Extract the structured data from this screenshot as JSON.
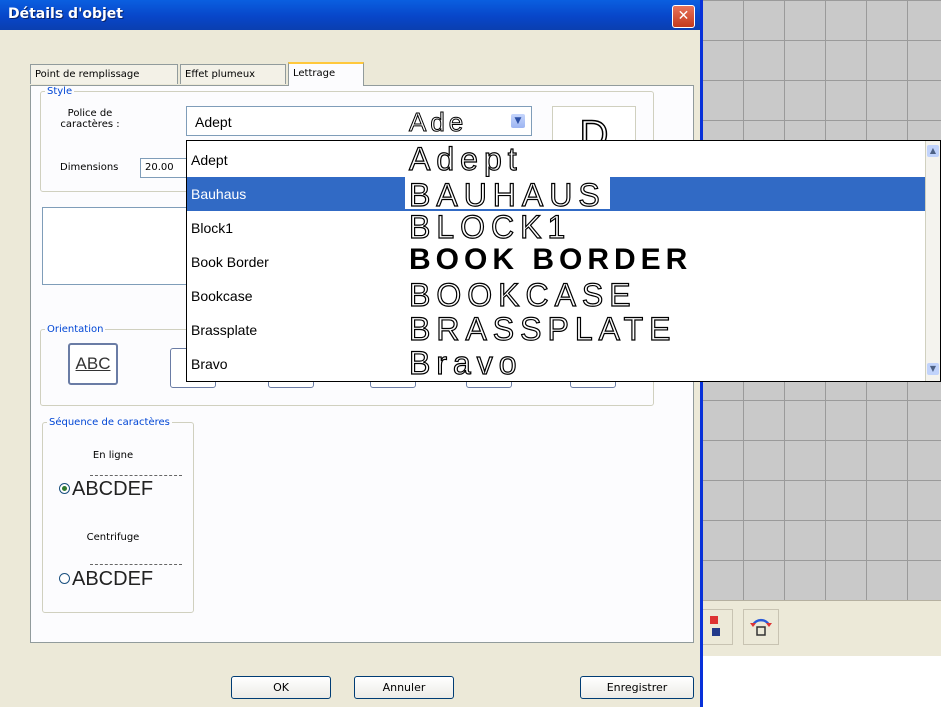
{
  "window": {
    "title": "Détails d'objet",
    "close_glyph": "✕"
  },
  "tabs": [
    {
      "label": "Point de remplissage"
    },
    {
      "label": "Effet plumeux"
    },
    {
      "label": "Lettrage"
    }
  ],
  "style_group": {
    "legend": "Style",
    "font_label_line1": "Police de",
    "font_label_line2": "caractères :",
    "font_value": "Adept",
    "font_preview": "Ade",
    "glyph_preview": "D",
    "dimensions_label": "Dimensions",
    "dimensions_value": "20.00"
  },
  "orientation_group": {
    "legend": "Orientation",
    "selected_label": "ABC"
  },
  "sequence_group": {
    "legend": "Séquence de caractères",
    "option1_label": "En ligne",
    "option1_sample": "ABCDEF",
    "option1_checked": true,
    "option2_label": "Centrifuge",
    "option2_sample": "ABCDEF",
    "option2_checked": false
  },
  "buttons": {
    "ok": "OK",
    "cancel": "Annuler",
    "save": "Enregistrer"
  },
  "font_dropdown": {
    "selected": "Bauhaus",
    "items": [
      {
        "name": "Adept",
        "preview": "Adept"
      },
      {
        "name": "Bauhaus",
        "preview": "BAUHAUS"
      },
      {
        "name": "Block1",
        "preview": "BLOCK1"
      },
      {
        "name": "Book Border",
        "preview": "BOOK BORDER"
      },
      {
        "name": "Bookcase",
        "preview": "BOOKCASE"
      },
      {
        "name": "Brassplate",
        "preview": "BRASSPLATE"
      },
      {
        "name": "Bravo",
        "preview": "Bravo"
      }
    ]
  },
  "colors": {
    "titlebar": "#0846c9",
    "selection": "#316ac5",
    "dialog_bg": "#ece9d8"
  }
}
